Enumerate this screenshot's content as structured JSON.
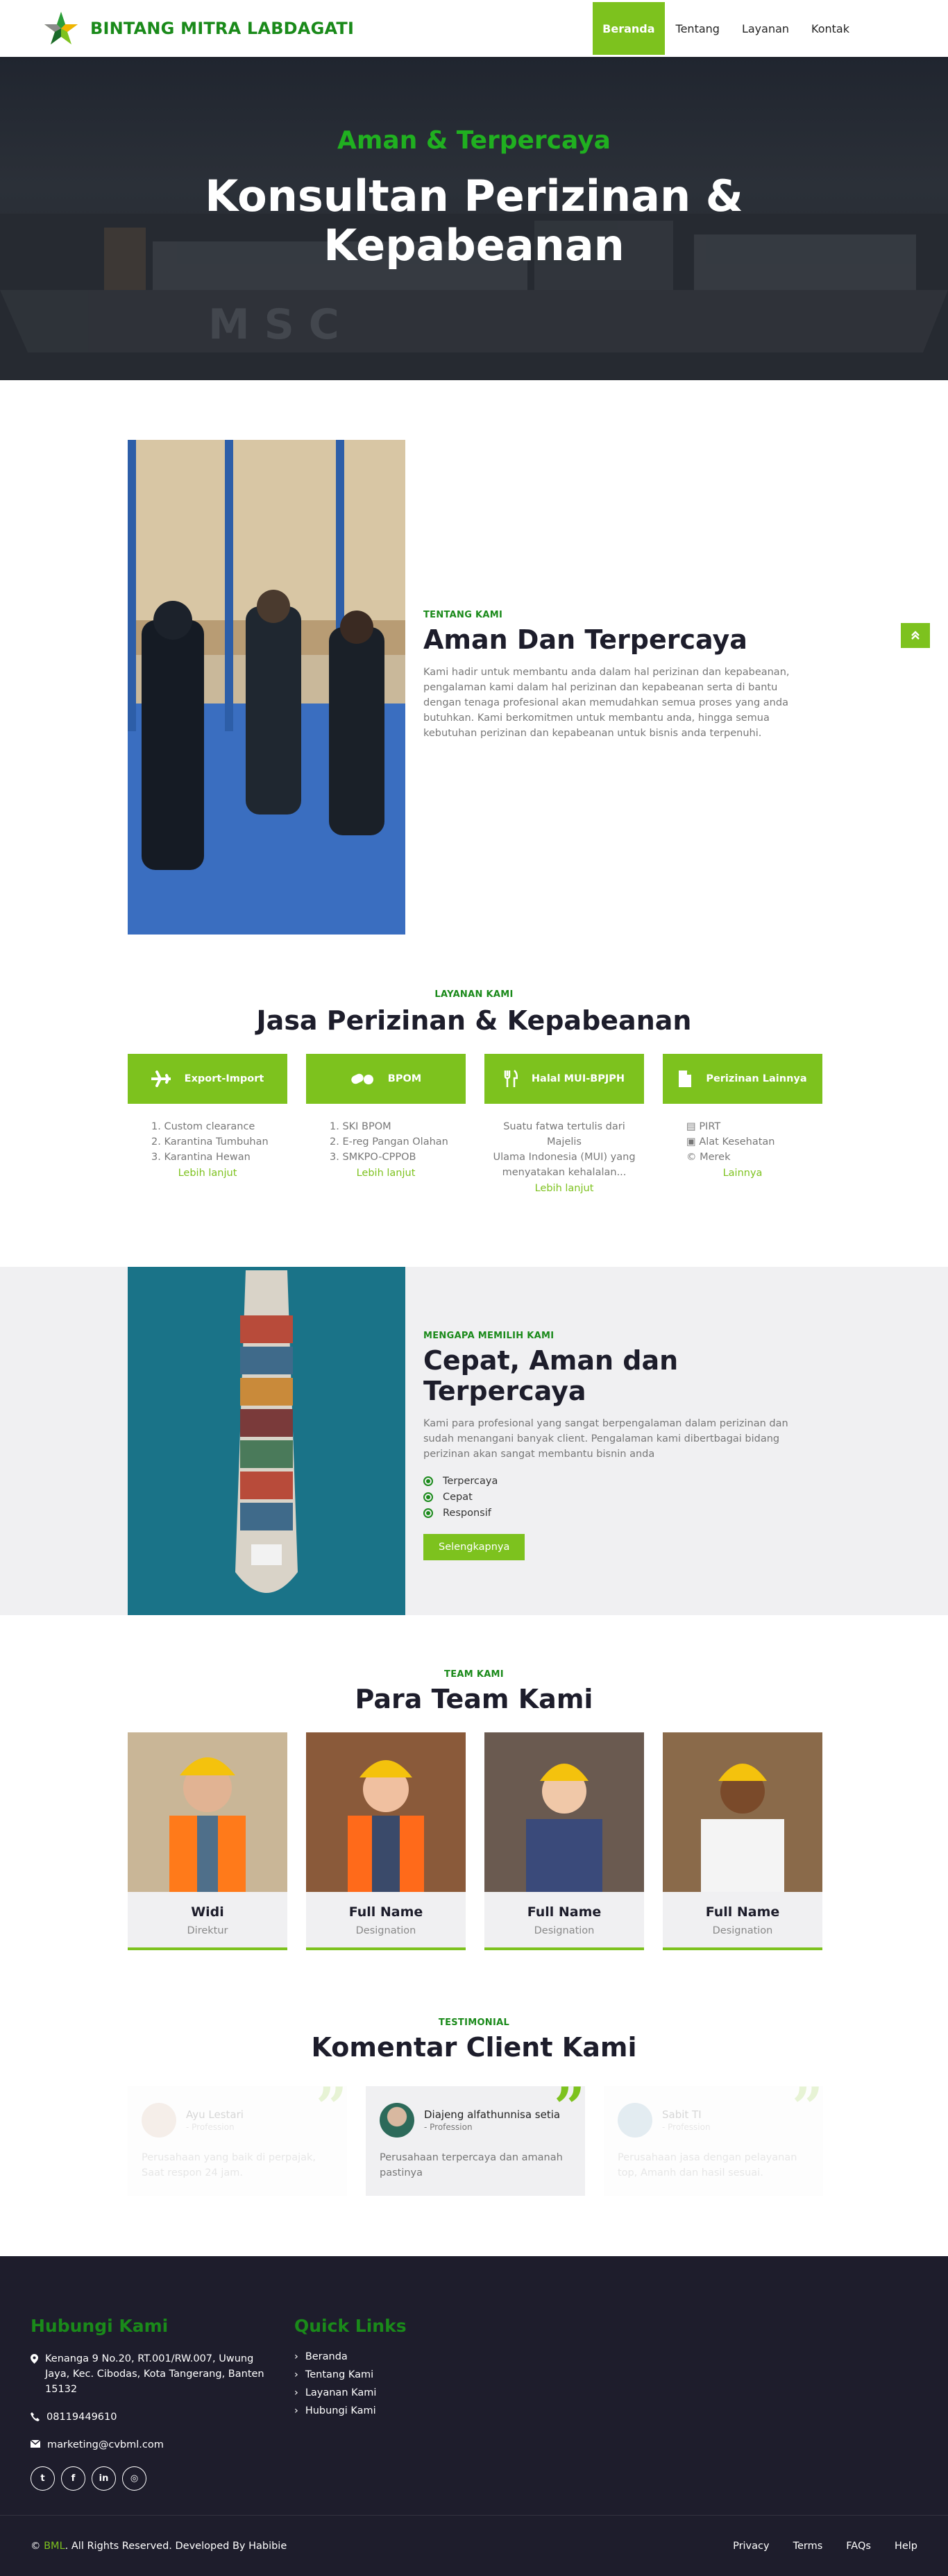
{
  "brand": {
    "name": "BINTANG MITRA LABDAGATI"
  },
  "nav": [
    {
      "label": "Beranda",
      "active": true
    },
    {
      "label": "Tentang",
      "active": false
    },
    {
      "label": "Layanan",
      "active": false
    },
    {
      "label": "Kontak",
      "active": false
    }
  ],
  "hero": {
    "subtitle": "Aman & Terpercaya",
    "title_line1": "Konsultan Perizinan &",
    "title_line2": "Kepabeanan"
  },
  "about": {
    "kicker": "TENTANG KAMI",
    "title": "Aman Dan Terpercaya",
    "text": "Kami hadir untuk membantu anda dalam hal perizinan dan kepabeanan, pengalaman kami dalam hal perizinan dan kepabeanan serta di bantu dengan tenaga profesional akan memudahkan semua proses yang anda butuhkan. Kami berkomitmen untuk membantu anda, hingga semua kebutuhan perizinan dan kepabeanan untuk bisnis anda terpenuhi."
  },
  "services": {
    "kicker": "LAYANAN KAMI",
    "title": "Jasa Perizinan & Kepabeanan",
    "items": [
      {
        "title": "Export-Import",
        "icon": "plane-icon",
        "lines": [
          "1. Custom clearance",
          "2. Karantina Tumbuhan",
          "3. Karantina Hewan"
        ],
        "link": "Lebih lanjut"
      },
      {
        "title": "BPOM",
        "icon": "pills-icon",
        "lines": [
          "1. SKI BPOM",
          "2. E-reg Pangan Olahan",
          "3. SMKPO-CPPOB"
        ],
        "link": "Lebih lanjut"
      },
      {
        "title": "Halal MUI-BPJPH",
        "icon": "utensils-icon",
        "lines": [
          "Suatu fatwa tertulis dari Majelis",
          "Ulama Indonesia (MUI) yang",
          "menyatakan kehalalan..."
        ],
        "link": "Lebih lanjut"
      },
      {
        "title": "Perizinan Lainnya",
        "icon": "document-icon",
        "lines": [
          "PIRT",
          "Alat Kesehatan",
          "Merek"
        ],
        "link": "Lainnya"
      }
    ]
  },
  "why": {
    "kicker": "MENGAPA MEMILIH KAMI",
    "title": "Cepat, Aman dan Terpercaya",
    "text": "Kami para profesional yang sangat berpengalaman dalam perizinan dan sudah menangani banyak client. Pengalaman kami dibertbagai bidang perizinan akan sangat membantu bisnin anda",
    "points": [
      "Terpercaya",
      "Cepat",
      "Responsif"
    ],
    "button": "Selengkapnya"
  },
  "team": {
    "kicker": "TEAM KAMI",
    "title": "Para Team Kami",
    "members": [
      {
        "name": "Widi",
        "role": "Direktur"
      },
      {
        "name": "Full Name",
        "role": "Designation"
      },
      {
        "name": "Full Name",
        "role": "Designation"
      },
      {
        "name": "Full Name",
        "role": "Designation"
      }
    ]
  },
  "testimonial": {
    "kicker": "TESTIMONIAL",
    "title": "Komentar Client Kami",
    "items": [
      {
        "name": "Ayu Lestari",
        "profession": "- Profession",
        "text": "Perusahaan yang baik di perpajak, Saat respon 24 jam."
      },
      {
        "name": "Diajeng alfathunnisa setia",
        "profession": "- Profession",
        "text": "Perusahaan terpercaya dan amanah pastinya"
      },
      {
        "name": "Sabit TI",
        "profession": "- Profession",
        "text": "Perusahaan jasa dengan pelayanan top, Amanh dan hasil sesuai."
      }
    ]
  },
  "footer": {
    "contact_title": "Hubungi Kami",
    "address": "Kenanga 9 No.20, RT.001/RW.007, Uwung Jaya, Kec. Cibodas, Kota Tangerang, Banten 15132",
    "phone": "08119449610",
    "email": "marketing@cvbml.com",
    "links_title": "Quick Links",
    "links": [
      "Beranda",
      "Tentang Kami",
      "Layanan Kami",
      "Hubungi Kami"
    ],
    "copyright_brand": "BML",
    "copyright_prefix": "©",
    "copyright_text": ". All Rights Reserved. Developed By Habibie",
    "bottom_links": [
      "Privacy",
      "Terms",
      "FAQs",
      "Help"
    ]
  }
}
